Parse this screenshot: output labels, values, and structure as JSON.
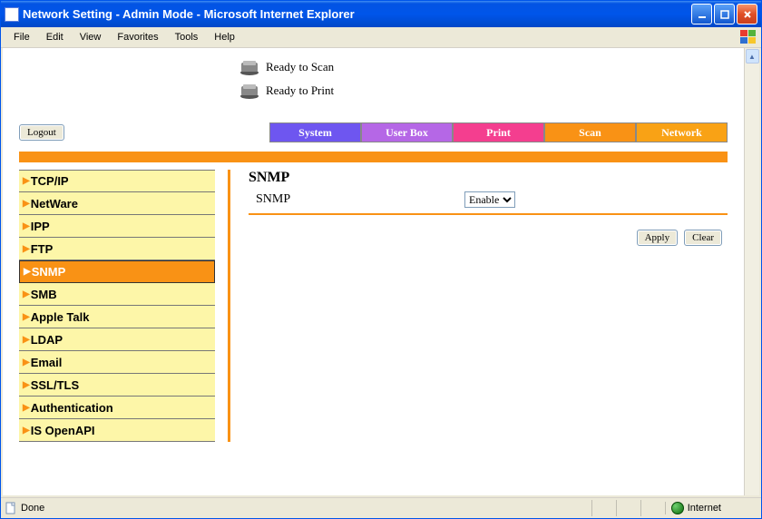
{
  "window": {
    "title": "Network Setting - Admin Mode - Microsoft Internet Explorer"
  },
  "menu": {
    "items": [
      "File",
      "Edit",
      "View",
      "Favorites",
      "Tools",
      "Help"
    ]
  },
  "status": {
    "scan": "Ready to Scan",
    "print": "Ready to Print"
  },
  "logout": {
    "label": "Logout"
  },
  "tabs": {
    "system": "System",
    "userbox": "User Box",
    "print": "Print",
    "scan": "Scan",
    "network": "Network"
  },
  "sidebar": {
    "items": [
      {
        "label": "TCP/IP",
        "active": false
      },
      {
        "label": "NetWare",
        "active": false
      },
      {
        "label": "IPP",
        "active": false
      },
      {
        "label": "FTP",
        "active": false
      },
      {
        "label": "SNMP",
        "active": true
      },
      {
        "label": "SMB",
        "active": false
      },
      {
        "label": "Apple Talk",
        "active": false
      },
      {
        "label": "LDAP",
        "active": false
      },
      {
        "label": "Email",
        "active": false
      },
      {
        "label": "SSL/TLS",
        "active": false
      },
      {
        "label": "Authentication",
        "active": false
      },
      {
        "label": "IS OpenAPI",
        "active": false
      }
    ]
  },
  "main": {
    "heading": "SNMP",
    "field_label": "SNMP",
    "field_value": "Enable",
    "actions": {
      "apply": "Apply",
      "clear": "Clear"
    }
  },
  "statusbar": {
    "text": "Done",
    "zone": "Internet"
  }
}
